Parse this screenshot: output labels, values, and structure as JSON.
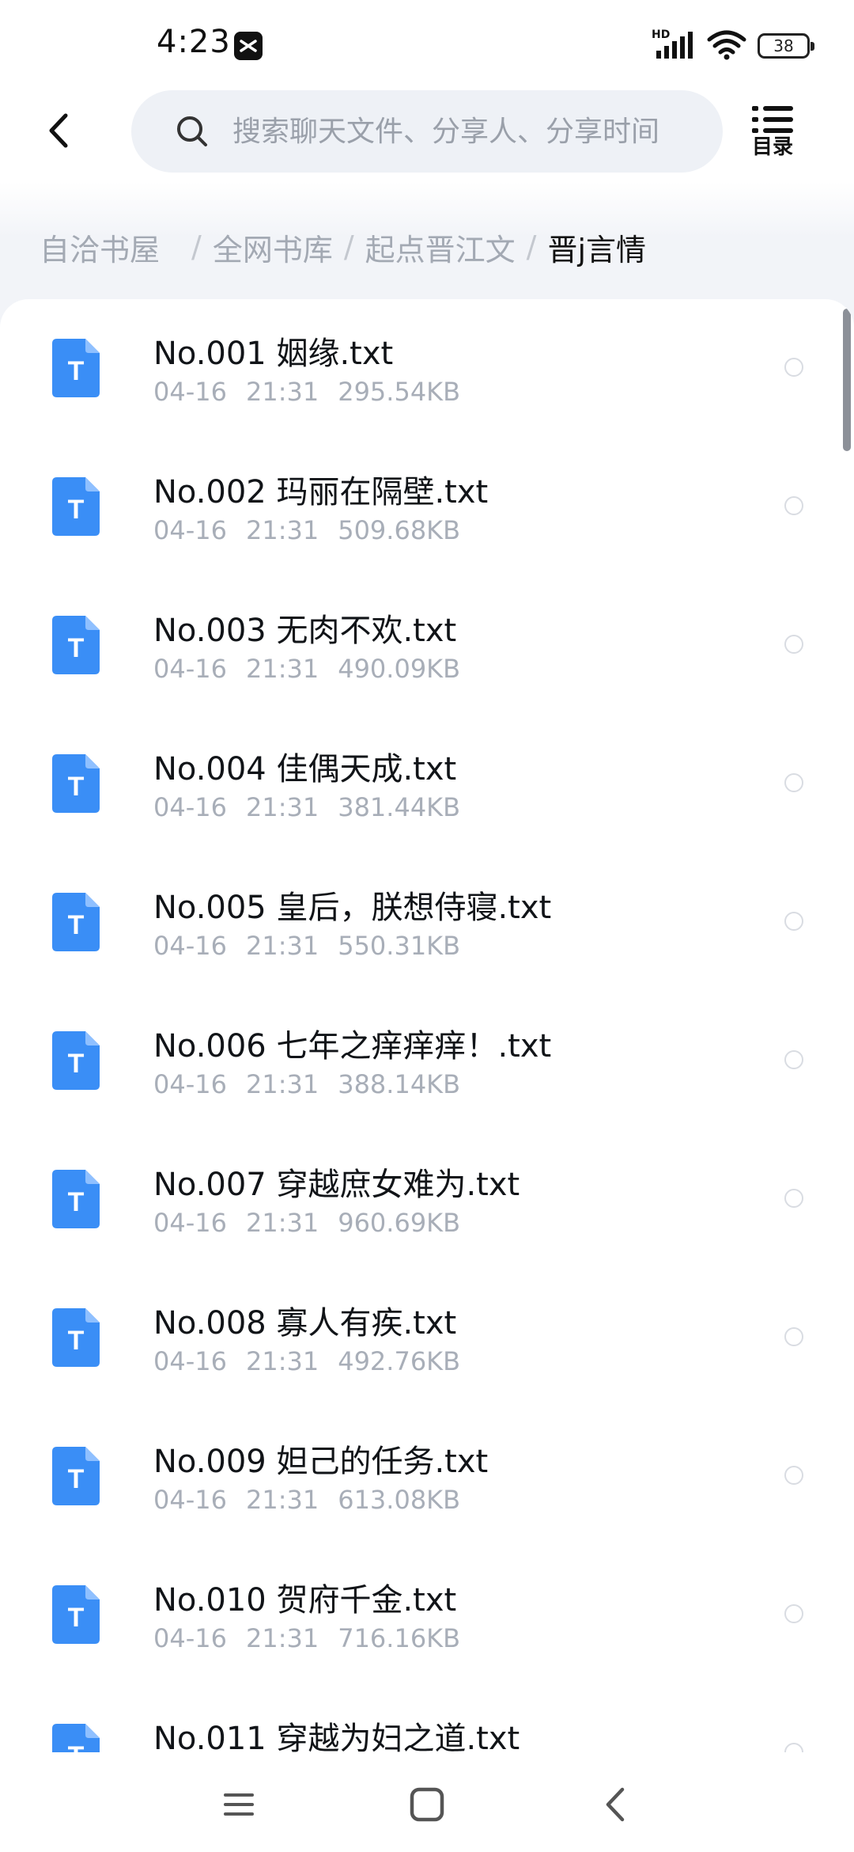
{
  "status_bar": {
    "time": "4:23",
    "network_label": "HD",
    "battery_level": "38"
  },
  "header": {
    "search_placeholder": "搜索聊天文件、分享人、分享时间",
    "toc_label": "目录"
  },
  "breadcrumb": [
    {
      "label": "自洽书屋"
    },
    {
      "label": "全网书库"
    },
    {
      "label": "起点晋江文"
    },
    {
      "label": "晋j言情"
    }
  ],
  "files": [
    {
      "name": "No.001 姻缘.txt",
      "date": "04-16",
      "time": "21:31",
      "size": "295.54KB"
    },
    {
      "name": "No.002 玛丽在隔壁.txt",
      "date": "04-16",
      "time": "21:31",
      "size": "509.68KB"
    },
    {
      "name": "No.003 无肉不欢.txt",
      "date": "04-16",
      "time": "21:31",
      "size": "490.09KB"
    },
    {
      "name": "No.004 佳偶天成.txt",
      "date": "04-16",
      "time": "21:31",
      "size": "381.44KB"
    },
    {
      "name": "No.005 皇后，朕想侍寝.txt",
      "date": "04-16",
      "time": "21:31",
      "size": "550.31KB"
    },
    {
      "name": "No.006 七年之痒痒痒！.txt",
      "date": "04-16",
      "time": "21:31",
      "size": "388.14KB"
    },
    {
      "name": "No.007 穿越庶女难为.txt",
      "date": "04-16",
      "time": "21:31",
      "size": "960.69KB"
    },
    {
      "name": "No.008 寡人有疾.txt",
      "date": "04-16",
      "time": "21:31",
      "size": "492.76KB"
    },
    {
      "name": "No.009 妲己的任务.txt",
      "date": "04-16",
      "time": "21:31",
      "size": "613.08KB"
    },
    {
      "name": "No.010 贺府千金.txt",
      "date": "04-16",
      "time": "21:31",
      "size": "716.16KB"
    },
    {
      "name": "No.011 穿越为妇之道.txt",
      "date": "",
      "time": "",
      "size": ""
    }
  ],
  "file_icon_letter": "T",
  "colors": {
    "accent": "#3a8ef6",
    "text_primary": "#111418",
    "text_secondary": "#a8aeb8"
  },
  "icons": {
    "back": "chevron-left-icon",
    "search": "search-icon",
    "toc": "list-icon",
    "file": "text-file-icon",
    "nav_menu": "menu-icon",
    "nav_home": "square-icon",
    "nav_back": "chevron-left-icon"
  }
}
